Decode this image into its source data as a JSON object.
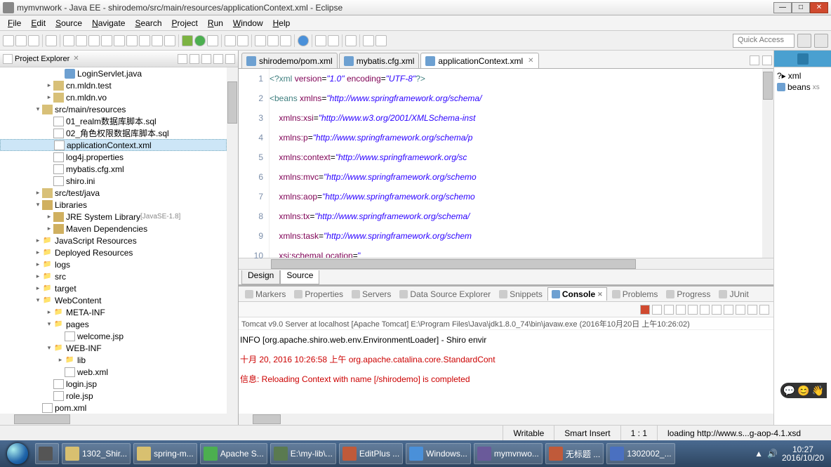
{
  "window": {
    "title": "mymvnwork - Java EE - shirodemo/src/main/resources/applicationContext.xml - Eclipse"
  },
  "win_buttons": {
    "min": "—",
    "max": "□",
    "close": "✕"
  },
  "menus": [
    "File",
    "Edit",
    "Source",
    "Navigate",
    "Search",
    "Project",
    "Run",
    "Window",
    "Help"
  ],
  "quick_access": "Quick Access",
  "project_explorer": {
    "title": "Project Explorer",
    "items": [
      {
        "indent": 5,
        "icon": "java",
        "label": "LoginServlet.java"
      },
      {
        "indent": 4,
        "icon": "pkg",
        "label": "cn.mldn.test",
        "toggle": "▸"
      },
      {
        "indent": 4,
        "icon": "pkg",
        "label": "cn.mldn.vo",
        "toggle": "▸"
      },
      {
        "indent": 3,
        "icon": "pkg",
        "label": "src/main/resources",
        "toggle": "▾"
      },
      {
        "indent": 4,
        "icon": "file",
        "label": "01_realm数据库脚本.sql"
      },
      {
        "indent": 4,
        "icon": "file",
        "label": "02_角色权限数据库脚本.sql"
      },
      {
        "indent": 4,
        "icon": "xml",
        "label": "applicationContext.xml",
        "selected": true
      },
      {
        "indent": 4,
        "icon": "file",
        "label": "log4j.properties"
      },
      {
        "indent": 4,
        "icon": "xml",
        "label": "mybatis.cfg.xml"
      },
      {
        "indent": 4,
        "icon": "file",
        "label": "shiro.ini"
      },
      {
        "indent": 3,
        "icon": "pkg",
        "label": "src/test/java",
        "toggle": "▸"
      },
      {
        "indent": 3,
        "icon": "jar",
        "label": "Libraries",
        "toggle": "▾"
      },
      {
        "indent": 4,
        "icon": "jar",
        "label": "JRE System Library",
        "suffix": "[JavaSE-1.8]",
        "toggle": "▸"
      },
      {
        "indent": 4,
        "icon": "jar",
        "label": "Maven Dependencies",
        "toggle": "▸"
      },
      {
        "indent": 3,
        "icon": "folder",
        "label": "JavaScript Resources",
        "toggle": "▸"
      },
      {
        "indent": 3,
        "icon": "folder",
        "label": "Deployed Resources",
        "toggle": "▸"
      },
      {
        "indent": 3,
        "icon": "folder",
        "label": "logs",
        "toggle": "▸"
      },
      {
        "indent": 3,
        "icon": "folder",
        "label": "src",
        "toggle": "▸"
      },
      {
        "indent": 3,
        "icon": "folder",
        "label": "target",
        "toggle": "▸"
      },
      {
        "indent": 3,
        "icon": "folder",
        "label": "WebContent",
        "toggle": "▾"
      },
      {
        "indent": 4,
        "icon": "folder",
        "label": "META-INF",
        "toggle": "▸"
      },
      {
        "indent": 4,
        "icon": "folder",
        "label": "pages",
        "toggle": "▾"
      },
      {
        "indent": 5,
        "icon": "file",
        "label": "welcome.jsp"
      },
      {
        "indent": 4,
        "icon": "folder",
        "label": "WEB-INF",
        "toggle": "▾"
      },
      {
        "indent": 5,
        "icon": "folder",
        "label": "lib",
        "toggle": "▸"
      },
      {
        "indent": 5,
        "icon": "xml",
        "label": "web.xml"
      },
      {
        "indent": 4,
        "icon": "file",
        "label": "login.jsp"
      },
      {
        "indent": 4,
        "icon": "file",
        "label": "role.jsp"
      },
      {
        "indent": 3,
        "icon": "xml",
        "label": "pom.xml"
      }
    ]
  },
  "editor_tabs": [
    {
      "label": "shirodemo/pom.xml",
      "active": false
    },
    {
      "label": "mybatis.cfg.xml",
      "active": false
    },
    {
      "label": "applicationContext.xml",
      "active": true
    }
  ],
  "code_lines": [
    {
      "n": "1",
      "html": "<span class='tag'>&lt;?xml</span> <span class='attr'>version</span>=<span class='str'>\"1.0\"</span> <span class='attr'>encoding</span>=<span class='str'>\"UTF-8\"</span><span class='tag'>?&gt;</span>"
    },
    {
      "n": "2",
      "html": "<span class='tag'>&lt;beans</span> <span class='attr'>xmlns</span>=<span class='str'>\"http://www.springframework.org/schema/</span>"
    },
    {
      "n": "3",
      "html": "    <span class='attr'>xmlns:xsi</span>=<span class='str'>\"http://www.w3.org/2001/XMLSchema-inst</span>"
    },
    {
      "n": "4",
      "html": "    <span class='attr'>xmlns:p</span>=<span class='str'>\"http://www.springframework.org/schema/p</span>"
    },
    {
      "n": "5",
      "html": "    <span class='attr'>xmlns:context</span>=<span class='str'>\"http://www.springframework.org/sc</span>"
    },
    {
      "n": "6",
      "html": "    <span class='attr'>xmlns:mvc</span>=<span class='str'>\"http://www.springframework.org/schemo</span>"
    },
    {
      "n": "7",
      "html": "    <span class='attr'>xmlns:aop</span>=<span class='str'>\"http://www.springframework.org/schemo</span>"
    },
    {
      "n": "8",
      "html": "    <span class='attr'>xmlns:tx</span>=<span class='str'>\"http://www.springframework.org/schema/</span>"
    },
    {
      "n": "9",
      "html": "    <span class='attr'>xmlns:task</span>=<span class='str'>\"http://www.springframework.org/schem</span>"
    },
    {
      "n": "10",
      "html": "    <span class='attr'>xsi:schemaLocation</span>=<span class='str2'>\"</span>"
    }
  ],
  "design_source": {
    "design": "Design",
    "source": "Source"
  },
  "bottom_tabs": [
    "Markers",
    "Properties",
    "Servers",
    "Data Source Explorer",
    "Snippets",
    "Console",
    "Problems",
    "Progress",
    "JUnit"
  ],
  "bottom_active": "Console",
  "console": {
    "title": "Tomcat v9.0 Server at localhost [Apache Tomcat] E:\\Program Files\\Java\\jdk1.8.0_74\\bin\\javaw.exe (2016年10月20日 上午10:26:02)",
    "lines": [
      {
        "cls": "info",
        "text": "INFO [org.apache.shiro.web.env.EnvironmentLoader] - Shiro envir"
      },
      {
        "cls": "err",
        "text": "十月 20, 2016 10:26:58 上午 org.apache.catalina.core.StandardCont"
      },
      {
        "cls": "err",
        "text": "信息: Reloading Context with name [/shirodemo] is completed"
      }
    ]
  },
  "outline": {
    "xml": "xml",
    "beans": "beans",
    "beans_suffix": "xs"
  },
  "status": {
    "writable": "Writable",
    "insert": "Smart Insert",
    "pos": "1 : 1",
    "loading": "loading http://www.s...g-aop-4.1.xsd"
  },
  "taskbar": {
    "items": [
      {
        "label": "1302_Shir...",
        "color": "#d8c070"
      },
      {
        "label": "spring-m...",
        "color": "#d8c070"
      },
      {
        "label": "Apache S...",
        "color": "#4caf50"
      },
      {
        "label": "E:\\my-lib\\...",
        "color": "#5a7a50"
      },
      {
        "label": "EditPlus ...",
        "color": "#c05a3a"
      },
      {
        "label": "Windows...",
        "color": "#4a90d9"
      },
      {
        "label": "mymvnwo...",
        "color": "#6a5a9a"
      },
      {
        "label": "无标题 ...",
        "color": "#c05a3a"
      },
      {
        "label": "1302002_...",
        "color": "#4a70c0"
      }
    ],
    "clock_time": "10:27",
    "clock_date": "2016/10/20"
  }
}
